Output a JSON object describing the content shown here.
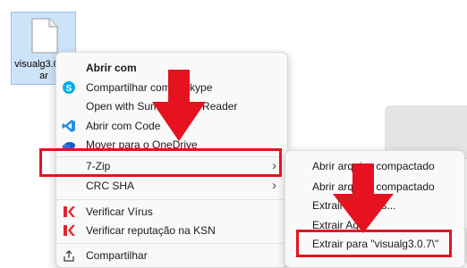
{
  "desktop": {
    "file_name": "visualg3.0.7.rar",
    "file_label_display": "visualg3.0.7.rar"
  },
  "context_menu": {
    "items": [
      {
        "label": "Abrir com",
        "icon": "none",
        "bold": true
      },
      {
        "label": "Compartilhar com o Skype",
        "icon": "skype-icon"
      },
      {
        "label": "Open with SumatraPDF Reader",
        "icon": "none"
      },
      {
        "label": "Abrir com Code",
        "icon": "vscode-icon"
      },
      {
        "label": "Mover para o OneDrive",
        "icon": "onedrive-icon"
      },
      {
        "label": "7-Zip",
        "icon": "none",
        "has_submenu": true
      },
      {
        "label": "CRC SHA",
        "icon": "none",
        "has_submenu": true
      },
      {
        "label": "Verificar Vírus",
        "icon": "kaspersky-icon"
      },
      {
        "label": "Verificar reputação na KSN",
        "icon": "kaspersky-icon"
      },
      {
        "label": "Compartilhar",
        "icon": "share-icon"
      }
    ]
  },
  "submenu_7zip": {
    "items": [
      {
        "label": "Abrir arquivo compactado"
      },
      {
        "label": "Abrir arquivo compactado"
      },
      {
        "label": "Extrair arquivos..."
      },
      {
        "label": "Extrair Aqui"
      },
      {
        "label": "Extrair para \"visualg3.0.7\\\""
      }
    ]
  },
  "colors": {
    "highlight_red": "#e6121f",
    "menu_background": "#f9f9f9",
    "selection_blue": "#cde3f7",
    "skype_blue": "#00aff0",
    "vscode_blue": "#2a8fe0",
    "onedrive_blue": "#0a5fcc",
    "kaspersky_red": "#e0272f"
  }
}
